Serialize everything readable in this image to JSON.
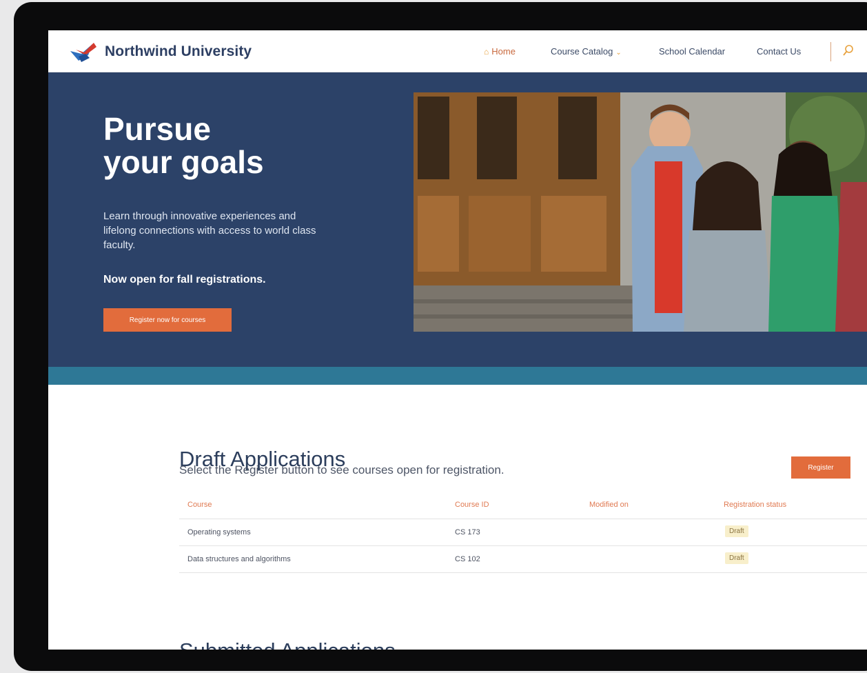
{
  "header": {
    "brand": "Northwind University",
    "nav": {
      "home": "Home",
      "catalog": "Course Catalog",
      "calendar": "School Calendar",
      "contact": "Contact Us"
    }
  },
  "hero": {
    "title_line1": "Pursue",
    "title_line2": "your goals",
    "description": "Learn through innovative experiences and lifelong connections with access to world class faculty.",
    "open_text": "Now open for fall registrations.",
    "button_label": "Register now for courses"
  },
  "draft": {
    "title": "Draft Applications",
    "subtitle": "Select the Register button to see courses open for registration.",
    "register_label": "Register",
    "columns": [
      "Course",
      "Course ID",
      "Modified on",
      "Registration status"
    ],
    "rows": [
      {
        "course": "Operating systems",
        "course_id": "CS 173",
        "modified_on": "",
        "status": "Draft"
      },
      {
        "course": "Data structures and algorithms",
        "course_id": "CS 102",
        "modified_on": "",
        "status": "Draft"
      }
    ]
  },
  "submitted": {
    "title": "Submitted Applications"
  },
  "icons": {
    "logo": "northwind-bird-logo",
    "home": "home-icon",
    "catalog_chevron": "chevron-down-icon",
    "search": "search-icon"
  },
  "colors": {
    "accent": "#e26c3c",
    "hero_bg": "#2c4268",
    "band": "#2e7896",
    "brand_text": "#2d3f63",
    "badge_bg": "#f8efcb"
  }
}
